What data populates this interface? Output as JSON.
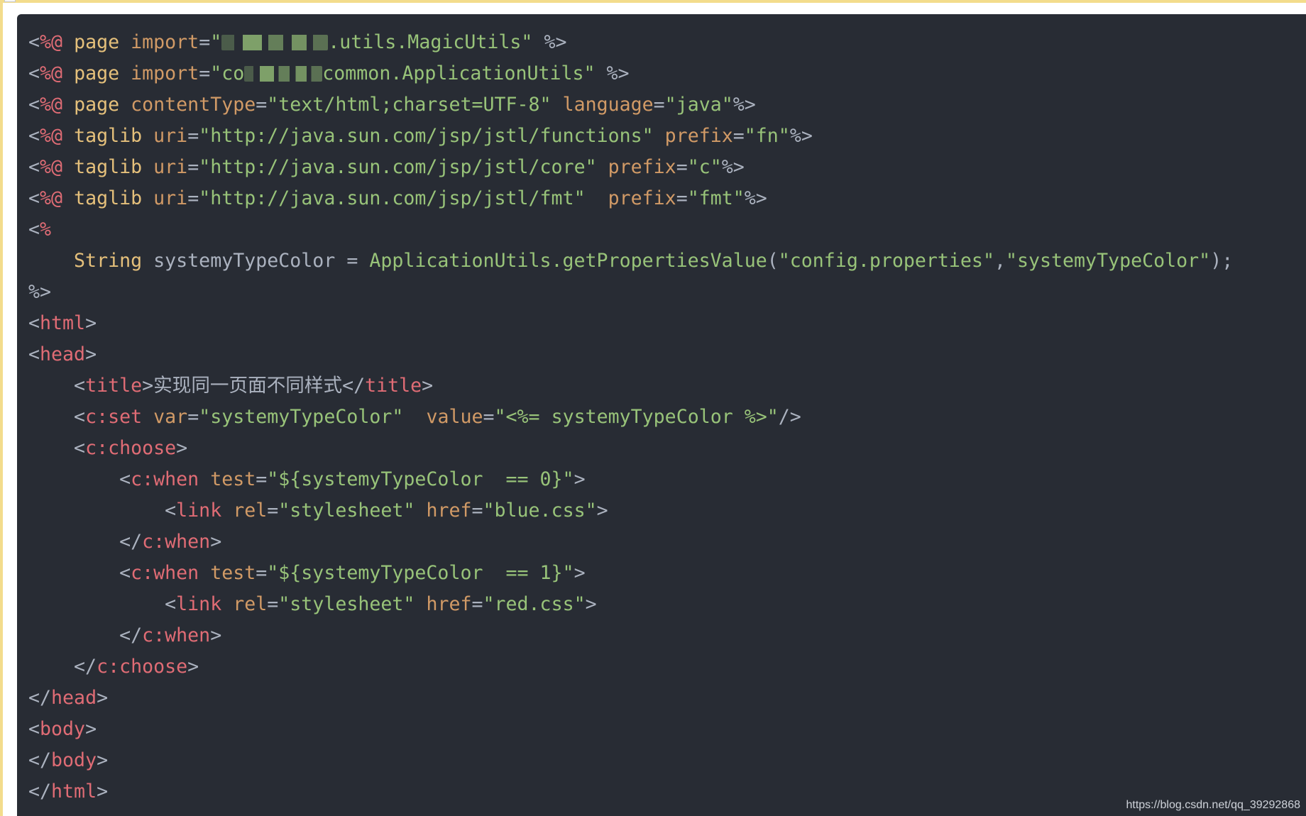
{
  "watermark": "https://blog.csdn.net/qq_39292868",
  "colors": {
    "background": "#282c34",
    "punctuation": "#abb2bf",
    "jsp_delimiter": "#e06c75",
    "attribute": "#d19a66",
    "string": "#98c379",
    "tag": "#e06c75",
    "keyword": "#e5c07b"
  },
  "code_lines": [
    [
      [
        "punct",
        "<"
      ],
      [
        "delim",
        "%@"
      ],
      [
        "text",
        " "
      ],
      [
        "keyword",
        "page"
      ],
      [
        "text",
        " "
      ],
      [
        "attr",
        "import"
      ],
      [
        "punct",
        "="
      ],
      [
        "string",
        "\""
      ],
      [
        "redacted",
        ""
      ],
      [
        "string",
        ".utils.MagicUtils\""
      ],
      [
        "text",
        " "
      ],
      [
        "punct",
        "%>"
      ]
    ],
    [
      [
        "punct",
        "<"
      ],
      [
        "delim",
        "%@"
      ],
      [
        "text",
        " "
      ],
      [
        "keyword",
        "page"
      ],
      [
        "text",
        " "
      ],
      [
        "attr",
        "import"
      ],
      [
        "punct",
        "="
      ],
      [
        "string",
        "\"co"
      ],
      [
        "redacted",
        ""
      ],
      [
        "string",
        "common.ApplicationUtils\""
      ],
      [
        "text",
        " "
      ],
      [
        "punct",
        "%>"
      ]
    ],
    [
      [
        "punct",
        "<"
      ],
      [
        "delim",
        "%@"
      ],
      [
        "text",
        " "
      ],
      [
        "keyword",
        "page"
      ],
      [
        "text",
        " "
      ],
      [
        "attr",
        "contentType"
      ],
      [
        "punct",
        "="
      ],
      [
        "string",
        "\"text/html;charset=UTF-8\""
      ],
      [
        "text",
        " "
      ],
      [
        "attr",
        "language"
      ],
      [
        "punct",
        "="
      ],
      [
        "string",
        "\"java\""
      ],
      [
        "punct",
        "%>"
      ]
    ],
    [
      [
        "punct",
        "<"
      ],
      [
        "delim",
        "%@"
      ],
      [
        "text",
        " "
      ],
      [
        "keyword",
        "taglib"
      ],
      [
        "text",
        " "
      ],
      [
        "attr",
        "uri"
      ],
      [
        "punct",
        "="
      ],
      [
        "string",
        "\"http://java.sun.com/jsp/jstl/functions\""
      ],
      [
        "text",
        " "
      ],
      [
        "attr",
        "prefix"
      ],
      [
        "punct",
        "="
      ],
      [
        "string",
        "\"fn\""
      ],
      [
        "punct",
        "%>"
      ]
    ],
    [
      [
        "punct",
        "<"
      ],
      [
        "delim",
        "%@"
      ],
      [
        "text",
        " "
      ],
      [
        "keyword",
        "taglib"
      ],
      [
        "text",
        " "
      ],
      [
        "attr",
        "uri"
      ],
      [
        "punct",
        "="
      ],
      [
        "string",
        "\"http://java.sun.com/jsp/jstl/core\""
      ],
      [
        "text",
        " "
      ],
      [
        "attr",
        "prefix"
      ],
      [
        "punct",
        "="
      ],
      [
        "string",
        "\"c\""
      ],
      [
        "punct",
        "%>"
      ]
    ],
    [
      [
        "punct",
        "<"
      ],
      [
        "delim",
        "%@"
      ],
      [
        "text",
        " "
      ],
      [
        "keyword",
        "taglib"
      ],
      [
        "text",
        " "
      ],
      [
        "attr",
        "uri"
      ],
      [
        "punct",
        "="
      ],
      [
        "string",
        "\"http://java.sun.com/jsp/jstl/fmt\""
      ],
      [
        "text",
        "  "
      ],
      [
        "attr",
        "prefix"
      ],
      [
        "punct",
        "="
      ],
      [
        "string",
        "\"fmt\""
      ],
      [
        "punct",
        "%>"
      ]
    ],
    [
      [
        "punct",
        "<"
      ],
      [
        "delim",
        "%"
      ]
    ],
    [
      [
        "text",
        "    "
      ],
      [
        "keyword",
        "String"
      ],
      [
        "text",
        " systemyTypeColor = "
      ],
      [
        "type",
        "ApplicationUtils.getPropertiesValue"
      ],
      [
        "punct",
        "("
      ],
      [
        "string",
        "\"config.properties\""
      ],
      [
        "punct",
        ","
      ],
      [
        "string",
        "\"systemyTypeColor\""
      ],
      [
        "punct",
        ");"
      ]
    ],
    [
      [
        "punct",
        "%>"
      ]
    ],
    [
      [
        "punct",
        "<"
      ],
      [
        "tag",
        "html"
      ],
      [
        "punct",
        ">"
      ]
    ],
    [
      [
        "punct",
        "<"
      ],
      [
        "tag",
        "head"
      ],
      [
        "punct",
        ">"
      ]
    ],
    [
      [
        "text",
        "    "
      ],
      [
        "punct",
        "<"
      ],
      [
        "tag",
        "title"
      ],
      [
        "punct",
        ">"
      ],
      [
        "text",
        "实现同一页面不同样式"
      ],
      [
        "punct",
        "</"
      ],
      [
        "tag",
        "title"
      ],
      [
        "punct",
        ">"
      ]
    ],
    [
      [
        "text",
        "    "
      ],
      [
        "punct",
        "<"
      ],
      [
        "tag",
        "c:set"
      ],
      [
        "text",
        " "
      ],
      [
        "attr",
        "var"
      ],
      [
        "punct",
        "="
      ],
      [
        "string",
        "\"systemyTypeColor\""
      ],
      [
        "text",
        "  "
      ],
      [
        "attr",
        "value"
      ],
      [
        "punct",
        "="
      ],
      [
        "string",
        "\"<%= systemyTypeColor %>\""
      ],
      [
        "punct",
        "/>"
      ]
    ],
    [
      [
        "text",
        "    "
      ],
      [
        "punct",
        "<"
      ],
      [
        "tag",
        "c:choose"
      ],
      [
        "punct",
        ">"
      ]
    ],
    [
      [
        "text",
        "        "
      ],
      [
        "punct",
        "<"
      ],
      [
        "tag",
        "c:when"
      ],
      [
        "text",
        " "
      ],
      [
        "attr",
        "test"
      ],
      [
        "punct",
        "="
      ],
      [
        "string",
        "\"${systemyTypeColor  == 0}\""
      ],
      [
        "punct",
        ">"
      ]
    ],
    [
      [
        "text",
        "            "
      ],
      [
        "punct",
        "<"
      ],
      [
        "tag",
        "link"
      ],
      [
        "text",
        " "
      ],
      [
        "attr",
        "rel"
      ],
      [
        "punct",
        "="
      ],
      [
        "string",
        "\"stylesheet\""
      ],
      [
        "text",
        " "
      ],
      [
        "attr",
        "href"
      ],
      [
        "punct",
        "="
      ],
      [
        "string",
        "\"blue.css\""
      ],
      [
        "punct",
        ">"
      ]
    ],
    [
      [
        "text",
        "        "
      ],
      [
        "punct",
        "</"
      ],
      [
        "tag",
        "c:when"
      ],
      [
        "punct",
        ">"
      ]
    ],
    [
      [
        "text",
        "        "
      ],
      [
        "punct",
        "<"
      ],
      [
        "tag",
        "c:when"
      ],
      [
        "text",
        " "
      ],
      [
        "attr",
        "test"
      ],
      [
        "punct",
        "="
      ],
      [
        "string",
        "\"${systemyTypeColor  == 1}\""
      ],
      [
        "punct",
        ">"
      ]
    ],
    [
      [
        "text",
        "            "
      ],
      [
        "punct",
        "<"
      ],
      [
        "tag",
        "link"
      ],
      [
        "text",
        " "
      ],
      [
        "attr",
        "rel"
      ],
      [
        "punct",
        "="
      ],
      [
        "string",
        "\"stylesheet\""
      ],
      [
        "text",
        " "
      ],
      [
        "attr",
        "href"
      ],
      [
        "punct",
        "="
      ],
      [
        "string",
        "\"red.css\""
      ],
      [
        "punct",
        ">"
      ]
    ],
    [
      [
        "text",
        "        "
      ],
      [
        "punct",
        "</"
      ],
      [
        "tag",
        "c:when"
      ],
      [
        "punct",
        ">"
      ]
    ],
    [
      [
        "text",
        "    "
      ],
      [
        "punct",
        "</"
      ],
      [
        "tag",
        "c:choose"
      ],
      [
        "punct",
        ">"
      ]
    ],
    [
      [
        "punct",
        "</"
      ],
      [
        "tag",
        "head"
      ],
      [
        "punct",
        ">"
      ]
    ],
    [
      [
        "punct",
        "<"
      ],
      [
        "tag",
        "body"
      ],
      [
        "punct",
        ">"
      ]
    ],
    [
      [
        "punct",
        "</"
      ],
      [
        "tag",
        "body"
      ],
      [
        "punct",
        ">"
      ]
    ],
    [
      [
        "punct",
        "</"
      ],
      [
        "tag",
        "html"
      ],
      [
        "punct",
        ">"
      ]
    ]
  ]
}
